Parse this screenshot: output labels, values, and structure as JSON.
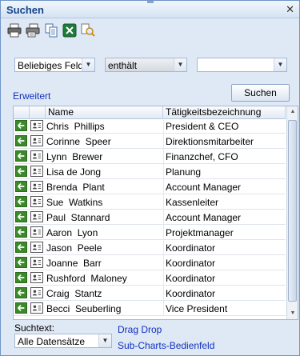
{
  "window": {
    "title": "Suchen",
    "close": "✕"
  },
  "toolbar": {
    "icons": [
      "print-icon",
      "print-preview-icon",
      "copy-icon",
      "excel-export-icon",
      "find-icon"
    ]
  },
  "filter": {
    "field": "Beliebiges Feld",
    "operator": "enthält",
    "value": ""
  },
  "advanced_link": "Erweitert",
  "search_button": "Suchen",
  "grid": {
    "headers": [
      "Name",
      "Tätigkeitsbezeichnung"
    ],
    "rows": [
      {
        "name": "Chris  Phillips",
        "job": "President & CEO"
      },
      {
        "name": "Corinne  Speer",
        "job": "Direktionsmitarbeiter"
      },
      {
        "name": "Lynn  Brewer",
        "job": "Finanzchef, CFO"
      },
      {
        "name": "Lisa de Jong",
        "job": "Planung"
      },
      {
        "name": "Brenda  Plant",
        "job": "Account Manager"
      },
      {
        "name": "Sue  Watkins",
        "job": "Kassenleiter"
      },
      {
        "name": "Paul  Stannard",
        "job": "Account Manager"
      },
      {
        "name": "Aaron  Lyon",
        "job": "Projektmanager"
      },
      {
        "name": "Jason  Peele",
        "job": "Koordinator"
      },
      {
        "name": "Joanne  Barr",
        "job": "Koordinator"
      },
      {
        "name": "Rushford  Maloney",
        "job": "Koordinator"
      },
      {
        "name": "Craig  Stantz",
        "job": "Koordinator"
      },
      {
        "name": "Becci  Seuberling",
        "job": "Vice President"
      }
    ]
  },
  "footer": {
    "suchtext_label": "Suchtext:",
    "scope": "Alle Datensätze",
    "drag_drop": "Drag  Drop",
    "subcharts": "Sub-Charts-Bedienfeld"
  }
}
